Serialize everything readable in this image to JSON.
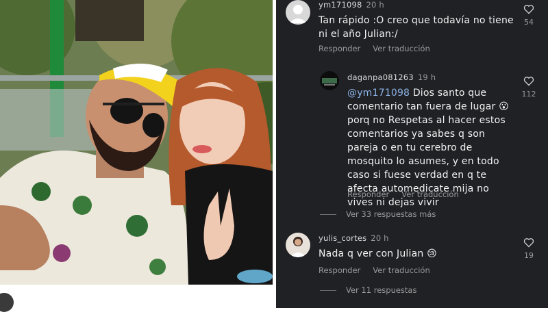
{
  "comments": [
    {
      "user": "ym171098",
      "time": "20 h",
      "text": "Tan rápido :O creo que todavía no tiene ni el año Julian:/",
      "reply": "Responder",
      "translate": "Ver traducción",
      "likes": "54",
      "avatar_icon": "default-profile-icon"
    },
    {
      "user": "daganpa081263",
      "time": "19 h",
      "mention": "@ym171098",
      "text": " Dios santo que comentario tan fuera de lugar 😮 porq no Respetas al hacer estos comentarios ya sabes q son pareja o en tu cerebro de mosquito lo asumes, y en todo caso si fuese verdad en q te afecta automedicate mija no vives ni dejas vivir",
      "reply": "Responder",
      "translate": "Ver traducción",
      "likes": "112",
      "more_replies": "Ver 33 respuestas más"
    },
    {
      "user": "yulis_cortes",
      "time": "20 h",
      "text": "Nada q ver con Julian 😢",
      "reply": "Responder",
      "translate": "Ver traducción",
      "likes": "19",
      "more_replies": "Ver 11 respuestas"
    }
  ],
  "colors": {
    "panel_bg": "#1f2125",
    "mention": "#8fb5e9",
    "muted": "#9a9a9a"
  }
}
